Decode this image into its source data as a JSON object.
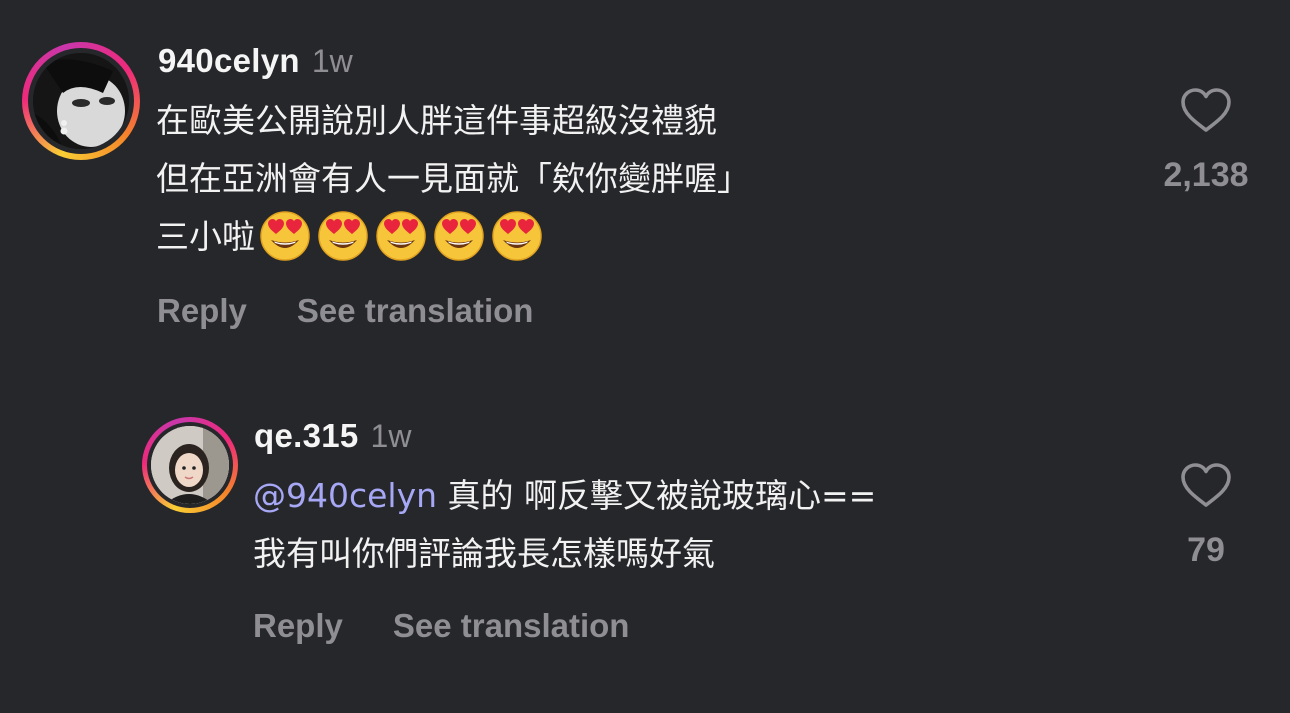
{
  "comments": [
    {
      "username": "940celyn",
      "timestamp": "1w",
      "lines": [
        "在歐美公開說別人胖這件事超級沒禮貌",
        "但在亞洲會有人一見面就「欸你變胖喔」",
        "三小啦"
      ],
      "emoji": [
        "heart-eyes-emoji",
        "heart-eyes-emoji",
        "heart-eyes-emoji",
        "heart-eyes-emoji",
        "heart-eyes-emoji"
      ],
      "like_count": "2,138",
      "reply_label": "Reply",
      "translate_label": "See translation"
    },
    {
      "username": "qe.315",
      "timestamp": "1w",
      "mention": "@940celyn",
      "lines": [
        " 真的 啊反擊又被說玻璃心==",
        "我有叫你們評論我長怎樣嗎好氣"
      ],
      "like_count": "79",
      "reply_label": "Reply",
      "translate_label": "See translation"
    }
  ],
  "colors": {
    "background": "#26272b",
    "secondary_text": "#8e8e93",
    "mention": "#a7a8f5"
  }
}
